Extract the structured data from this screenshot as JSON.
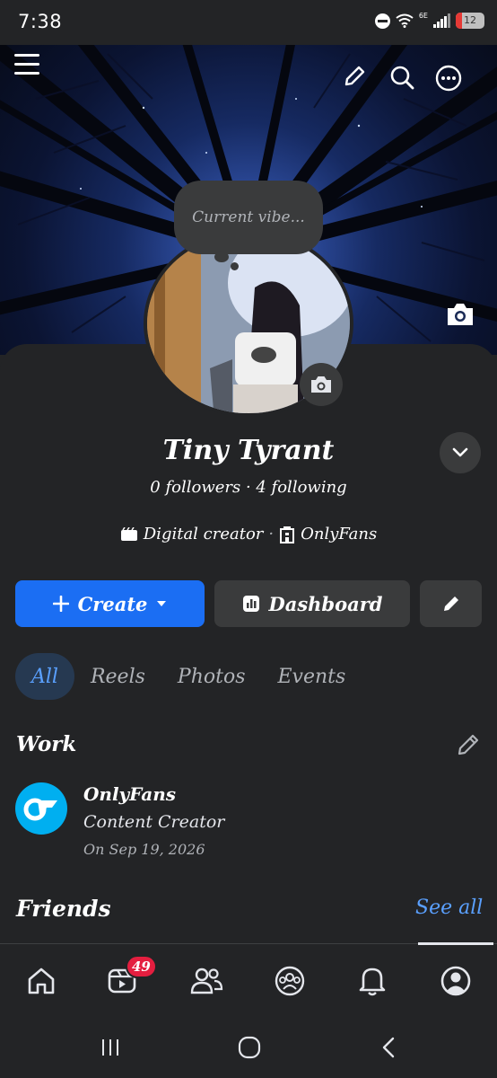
{
  "status_bar": {
    "time": "7:38",
    "network_label": "6E",
    "battery_level": "12"
  },
  "cover": {
    "icons": [
      "menu-icon",
      "pencil-icon",
      "search-icon",
      "more-icon",
      "camera-icon"
    ]
  },
  "profile": {
    "vibe_placeholder": "Current vibe...",
    "name": "Tiny Tyrant",
    "stats": "0 followers · 4 following",
    "category": "Digital creator",
    "separator": "·",
    "work_place": "OnlyFans"
  },
  "actions": {
    "create_label": "Create",
    "dashboard_label": "Dashboard"
  },
  "tabs": [
    {
      "label": "All",
      "active": true
    },
    {
      "label": "Reels",
      "active": false
    },
    {
      "label": "Photos",
      "active": false
    },
    {
      "label": "Events",
      "active": false
    }
  ],
  "work": {
    "title": "Work",
    "company": "OnlyFans",
    "role": "Content Creator",
    "date": "On Sep 19, 2026"
  },
  "friends": {
    "title": "Friends",
    "see_all": "See all"
  },
  "bottom_nav": {
    "items": [
      "home-icon",
      "reels-icon",
      "friends-icon",
      "groups-icon",
      "notifications-icon",
      "profile-icon"
    ],
    "reels_badge": "49",
    "active": "profile-icon"
  },
  "colors": {
    "background": "#232426",
    "accent_blue": "#1b6ef3",
    "link_blue": "#5aa0ff",
    "badge_red": "#e41e3f",
    "onlyfans_blue": "#00aff0"
  }
}
